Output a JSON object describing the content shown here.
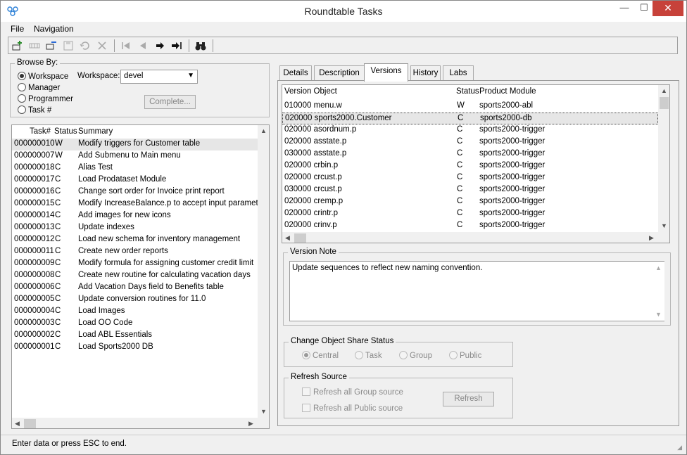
{
  "window": {
    "title": "Roundtable Tasks",
    "minimize": "—",
    "maximize": "☐",
    "close": "✕"
  },
  "menu": {
    "file": "File",
    "navigation": "Navigation"
  },
  "toolbar": {
    "buttons": [
      "add-task",
      "edit-task",
      "remove-row",
      "save",
      "undo",
      "delete",
      "first",
      "previous",
      "next",
      "last",
      "find"
    ]
  },
  "browse": {
    "label": "Browse By:",
    "options": [
      "Workspace",
      "Manager",
      "Programmer",
      "Task #"
    ],
    "selected": "Workspace",
    "workspace_label": "Workspace:",
    "workspace_value": "devel",
    "complete_label": "Complete..."
  },
  "tasks": {
    "headers": {
      "task": "Task#",
      "status": "Status",
      "summary": "Summary"
    },
    "rows": [
      {
        "task": "000000010",
        "status": "W",
        "summary": "Modify triggers for Customer table"
      },
      {
        "task": "000000007",
        "status": "W",
        "summary": "Add Submenu to Main menu"
      },
      {
        "task": "000000018",
        "status": "C",
        "summary": "Alias Test"
      },
      {
        "task": "000000017",
        "status": "C",
        "summary": "Load Prodataset Module"
      },
      {
        "task": "000000016",
        "status": "C",
        "summary": "Change sort order for Invoice print report"
      },
      {
        "task": "000000015",
        "status": "C",
        "summary": "Modify IncreaseBalance.p to accept input parameter"
      },
      {
        "task": "000000014",
        "status": "C",
        "summary": "Add images for new icons"
      },
      {
        "task": "000000013",
        "status": "C",
        "summary": "Update indexes"
      },
      {
        "task": "000000012",
        "status": "C",
        "summary": "Load new schema for inventory management"
      },
      {
        "task": "000000011",
        "status": "C",
        "summary": "Create new order reports"
      },
      {
        "task": "000000009",
        "status": "C",
        "summary": "Modify formula for assigning customer credit limit"
      },
      {
        "task": "000000008",
        "status": "C",
        "summary": "Create new routine for calculating vacation days"
      },
      {
        "task": "000000006",
        "status": "C",
        "summary": "Add Vacation Days field to Benefits table"
      },
      {
        "task": "000000005",
        "status": "C",
        "summary": "Update conversion routines for 11.0"
      },
      {
        "task": "000000004",
        "status": "C",
        "summary": "Load Images"
      },
      {
        "task": "000000003",
        "status": "C",
        "summary": "Load OO Code"
      },
      {
        "task": "000000002",
        "status": "C",
        "summary": "Load ABL Essentials"
      },
      {
        "task": "000000001",
        "status": "C",
        "summary": "Load Sports2000 DB"
      }
    ]
  },
  "tabs": [
    "Details",
    "Description",
    "Versions",
    "History",
    "Labs"
  ],
  "active_tab": "Versions",
  "versions": {
    "headers": {
      "object": "Version Object",
      "status": "Status",
      "module": "Product Module"
    },
    "rows": [
      {
        "object": "010000 menu.w",
        "status": "W",
        "module": "sports2000-abl"
      },
      {
        "object": "020000 sports2000.Customer",
        "status": "C",
        "module": "sports2000-db"
      },
      {
        "object": "020000 asordnum.p",
        "status": "C",
        "module": "sports2000-trigger"
      },
      {
        "object": "020000 asstate.p",
        "status": "C",
        "module": "sports2000-trigger"
      },
      {
        "object": "030000 asstate.p",
        "status": "C",
        "module": "sports2000-trigger"
      },
      {
        "object": "020000 crbin.p",
        "status": "C",
        "module": "sports2000-trigger"
      },
      {
        "object": "020000 crcust.p",
        "status": "C",
        "module": "sports2000-trigger"
      },
      {
        "object": "030000 crcust.p",
        "status": "C",
        "module": "sports2000-trigger"
      },
      {
        "object": "020000 cremp.p",
        "status": "C",
        "module": "sports2000-trigger"
      },
      {
        "object": "020000 crintr.p",
        "status": "C",
        "module": "sports2000-trigger"
      },
      {
        "object": "020000 crinv.p",
        "status": "C",
        "module": "sports2000-trigger"
      }
    ]
  },
  "version_note": {
    "label": "Version Note",
    "text": "Update sequences to reflect new naming convention."
  },
  "share_status": {
    "label": "Change Object Share Status",
    "options": [
      "Central",
      "Task",
      "Group",
      "Public"
    ],
    "selected": "Central"
  },
  "refresh": {
    "label": "Refresh Source",
    "group_label": "Refresh all Group source",
    "public_label": "Refresh all Public source",
    "button": "Refresh"
  },
  "status_bar": {
    "text": "Enter data or press ESC to end."
  }
}
